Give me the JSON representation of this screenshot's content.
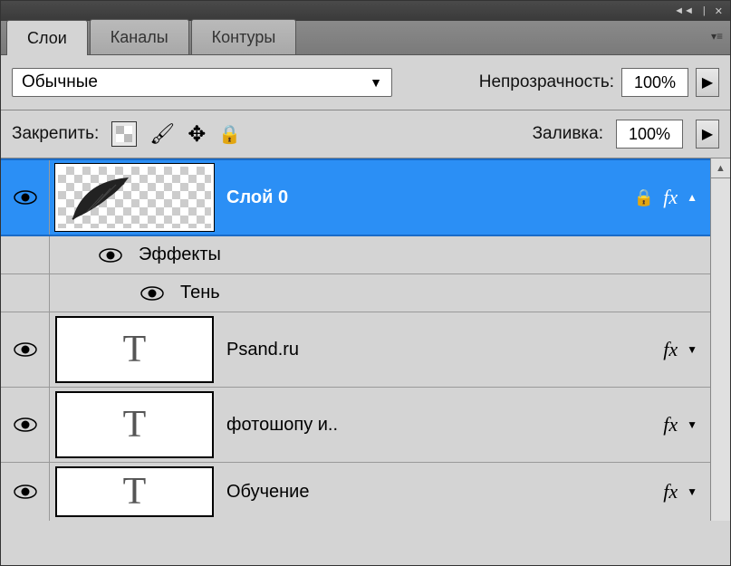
{
  "window": {
    "min_icon": "◄◄",
    "sep_icon": "|",
    "close_icon": "✕"
  },
  "tabs": {
    "layers": "Слои",
    "channels": "Каналы",
    "paths": "Контуры"
  },
  "options": {
    "blend_mode": "Обычные",
    "opacity_label": "Непрозрачность:",
    "opacity_value": "100%",
    "lock_label": "Закрепить:",
    "fill_label": "Заливка:",
    "fill_value": "100%"
  },
  "layers": [
    {
      "name": "Слой 0",
      "thumb": "feather",
      "selected": true,
      "locked": true,
      "fx": true,
      "expanded": true
    },
    {
      "name": "Psand.ru",
      "thumb": "T",
      "fx": true
    },
    {
      "name": "фотошопу и..",
      "thumb": "T",
      "fx": true
    },
    {
      "name": "Обучение",
      "thumb": "T",
      "fx": true
    }
  ],
  "effects": {
    "group_label": "Эффекты",
    "shadow_label": "Тень"
  },
  "glyphs": {
    "lock": "🔒",
    "fx": "fx",
    "up": "▲",
    "down": "▼",
    "right": "▶",
    "menu": "▾≡"
  }
}
